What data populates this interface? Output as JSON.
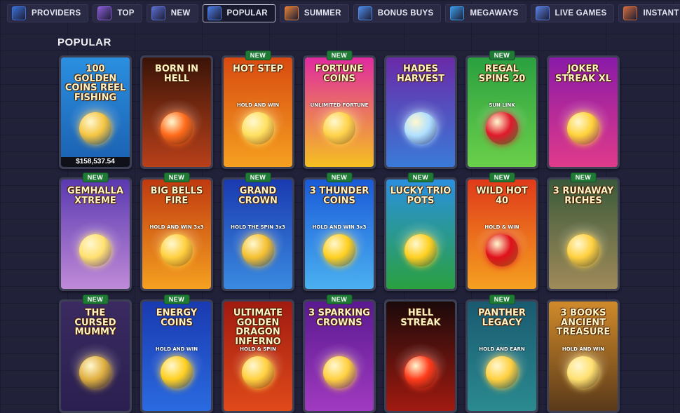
{
  "nav": {
    "tabs": [
      {
        "label": "PROVIDERS",
        "icon": "providers-icon",
        "color": "#3a6fd8",
        "active": false
      },
      {
        "label": "TOP",
        "icon": "top-icon",
        "color": "#8a5cd6",
        "active": false
      },
      {
        "label": "NEW",
        "icon": "bell-icon",
        "color": "#5b6fd0",
        "active": false
      },
      {
        "label": "POPULAR",
        "icon": "popular-icon",
        "color": "#4a7ae0",
        "active": true
      },
      {
        "label": "SUMMER",
        "icon": "summer-icon",
        "color": "#e0803a",
        "active": false
      },
      {
        "label": "BONUS BUYS",
        "icon": "bonus-icon",
        "color": "#4b8ae6",
        "active": false
      },
      {
        "label": "MEGAWAYS",
        "icon": "megaways-icon",
        "color": "#3a9ae6",
        "active": false
      },
      {
        "label": "LIVE GAMES",
        "icon": "globe-icon",
        "color": "#5a7ee0",
        "active": false
      },
      {
        "label": "INSTANT GAMES",
        "icon": "rocket-icon",
        "color": "#d06a3a",
        "active": false
      },
      {
        "label": "",
        "icon": "more-icon",
        "color": "#c03040",
        "active": false
      }
    ]
  },
  "section": {
    "title": "POPULAR"
  },
  "new_label": "NEW",
  "games": [
    {
      "title": "100 GOLDEN COINS REEL FISHING",
      "badge": false,
      "jackpot": "$158,537.54",
      "bg": [
        "#2a8fe0",
        "#1b5fb0"
      ],
      "accent": "#f5c542"
    },
    {
      "title": "BORN IN HELL",
      "badge": false,
      "bg": [
        "#3a1408",
        "#b8401a"
      ],
      "accent": "#ff6a1a"
    },
    {
      "title": "HOT STEP",
      "sub": "HOLD AND WIN",
      "badge": true,
      "bg": [
        "#d84a10",
        "#f5a020"
      ],
      "accent": "#ffe060"
    },
    {
      "title": "FORTUNE COINS",
      "sub": "UNLIMITED FORTUNE",
      "badge": true,
      "bg": [
        "#e02aa0",
        "#f5c020"
      ],
      "accent": "#ffd34a"
    },
    {
      "title": "HADES HARVEST",
      "badge": false,
      "bg": [
        "#6a2aa8",
        "#3a7ad8"
      ],
      "accent": "#b0e0ff"
    },
    {
      "title": "REGAL SPINS 20",
      "sub": "SUN LINK",
      "badge": true,
      "bg": [
        "#2aa040",
        "#6ad04a"
      ],
      "accent": "#e01a2a"
    },
    {
      "title": "JOKER STREAK XL",
      "badge": false,
      "bg": [
        "#8a1aa8",
        "#e03a8a"
      ],
      "accent": "#ffd23a"
    },
    {
      "title": "GEMHALLA XTREME",
      "badge": true,
      "bg": [
        "#5a3ab0",
        "#c08ad8"
      ],
      "accent": "#ffe070"
    },
    {
      "title": "BIG BELLS FIRE",
      "sub": "HOLD AND WIN 3x3",
      "badge": true,
      "bg": [
        "#c03a10",
        "#f5a020"
      ],
      "accent": "#ffd040"
    },
    {
      "title": "GRAND CROWN",
      "sub": "HOLD THE SPIN 3x3",
      "badge": true,
      "bg": [
        "#1a3ab0",
        "#3a8ae0"
      ],
      "accent": "#f5c030"
    },
    {
      "title": "3 THUNDER COINS",
      "sub": "HOLD AND WIN 3x3",
      "badge": true,
      "bg": [
        "#1a5ad8",
        "#4ab0f0"
      ],
      "accent": "#ffd020"
    },
    {
      "title": "LUCKY TRIO POTS",
      "badge": true,
      "bg": [
        "#2a90e0",
        "#2aa040"
      ],
      "accent": "#ffd020"
    },
    {
      "title": "WILD HOT 40",
      "sub": "HOLD & WIN",
      "badge": true,
      "bg": [
        "#e03a1a",
        "#f5a020"
      ],
      "accent": "#e0101a"
    },
    {
      "title": "3 RUNAWAY RICHES",
      "badge": true,
      "bg": [
        "#3a5a3a",
        "#a08a5a"
      ],
      "accent": "#ffd040"
    },
    {
      "title": "THE CURSED MUMMY",
      "badge": true,
      "bg": [
        "#3a2a60",
        "#2a2050"
      ],
      "accent": "#e0b040"
    },
    {
      "title": "ENERGY COINS",
      "sub": "HOLD AND WIN",
      "badge": true,
      "bg": [
        "#1a3ab0",
        "#2a6ae0"
      ],
      "accent": "#ffd020"
    },
    {
      "title": "ULTIMATE GOLDEN DRAGON INFERNO",
      "sub": "HOLD & SPIN",
      "badge": false,
      "bg": [
        "#a01a10",
        "#e04a1a"
      ],
      "accent": "#ffd040"
    },
    {
      "title": "3 SPARKING CROWNS",
      "badge": true,
      "bg": [
        "#5a1a90",
        "#a03ac0"
      ],
      "accent": "#ffd040"
    },
    {
      "title": "HELL STREAK",
      "badge": false,
      "bg": [
        "#1a0a0a",
        "#a01a10"
      ],
      "accent": "#ff3a1a"
    },
    {
      "title": "PANTHER LEGACY",
      "sub": "HOLD AND EARN",
      "badge": true,
      "bg": [
        "#1a5a70",
        "#2a8a90"
      ],
      "accent": "#ffd040"
    },
    {
      "title": "3 BOOKS ANCIENT TREASURE",
      "sub": "HOLD AND WIN",
      "badge": false,
      "bg": [
        "#d08a2a",
        "#5a3a1a"
      ],
      "accent": "#ffe070"
    }
  ]
}
